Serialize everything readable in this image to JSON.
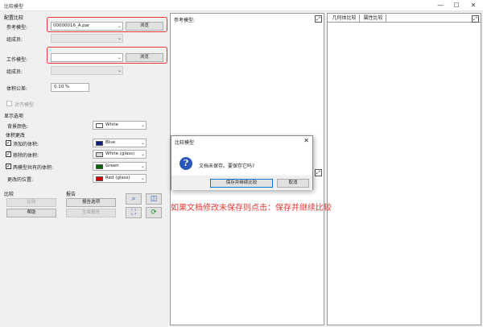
{
  "window": {
    "title": "比较模型",
    "minimize": "—",
    "maximize": "☐",
    "close": "✕"
  },
  "config": {
    "section": "配置比较",
    "ref_label": "参考模型:",
    "ref_value": "00000016_A.par",
    "browse": "浏览",
    "member_label": "组成员:",
    "work_label": "工作模型:",
    "work_value": "",
    "member2_label": "组成员:",
    "tolerance_label": "体积公差:",
    "tolerance_value": "0.10 %",
    "align_label": "对齐模型"
  },
  "display": {
    "section": "显示选项",
    "bg_label": "背景颜色:",
    "bg_value": "White",
    "volume_section": "体积更改",
    "added_label": "添加的体积:",
    "added_value": "Blue",
    "removed_label": "移除的体积:",
    "removed_value": "White (glass)",
    "shared_label": "两模型共有的体积:",
    "shared_value": "Green",
    "changed_label": "更改的位置:",
    "changed_value": "Red (glass)",
    "colors": {
      "white": "#ffffff",
      "blue": "#0d1f7a",
      "glass": "#d9d9d9",
      "green": "#006400",
      "red": "#d40000"
    }
  },
  "compare": {
    "section": "比较",
    "compare_button": "比较",
    "help_button": "帮助"
  },
  "report": {
    "section": "报告",
    "options_button": "报告选项",
    "generate_button": "生成报告"
  },
  "panes": {
    "reference": "参考模型:",
    "geometry_tab": "几何体比较",
    "property_tab": "属性比较"
  },
  "dialog": {
    "title": "比较模型",
    "message": "文档未保存。要保存它吗?",
    "save_button": "保存并继续比较",
    "cancel_button": "取消"
  },
  "annotation": "如果文档修改未保存则点击：保存并继续比较"
}
